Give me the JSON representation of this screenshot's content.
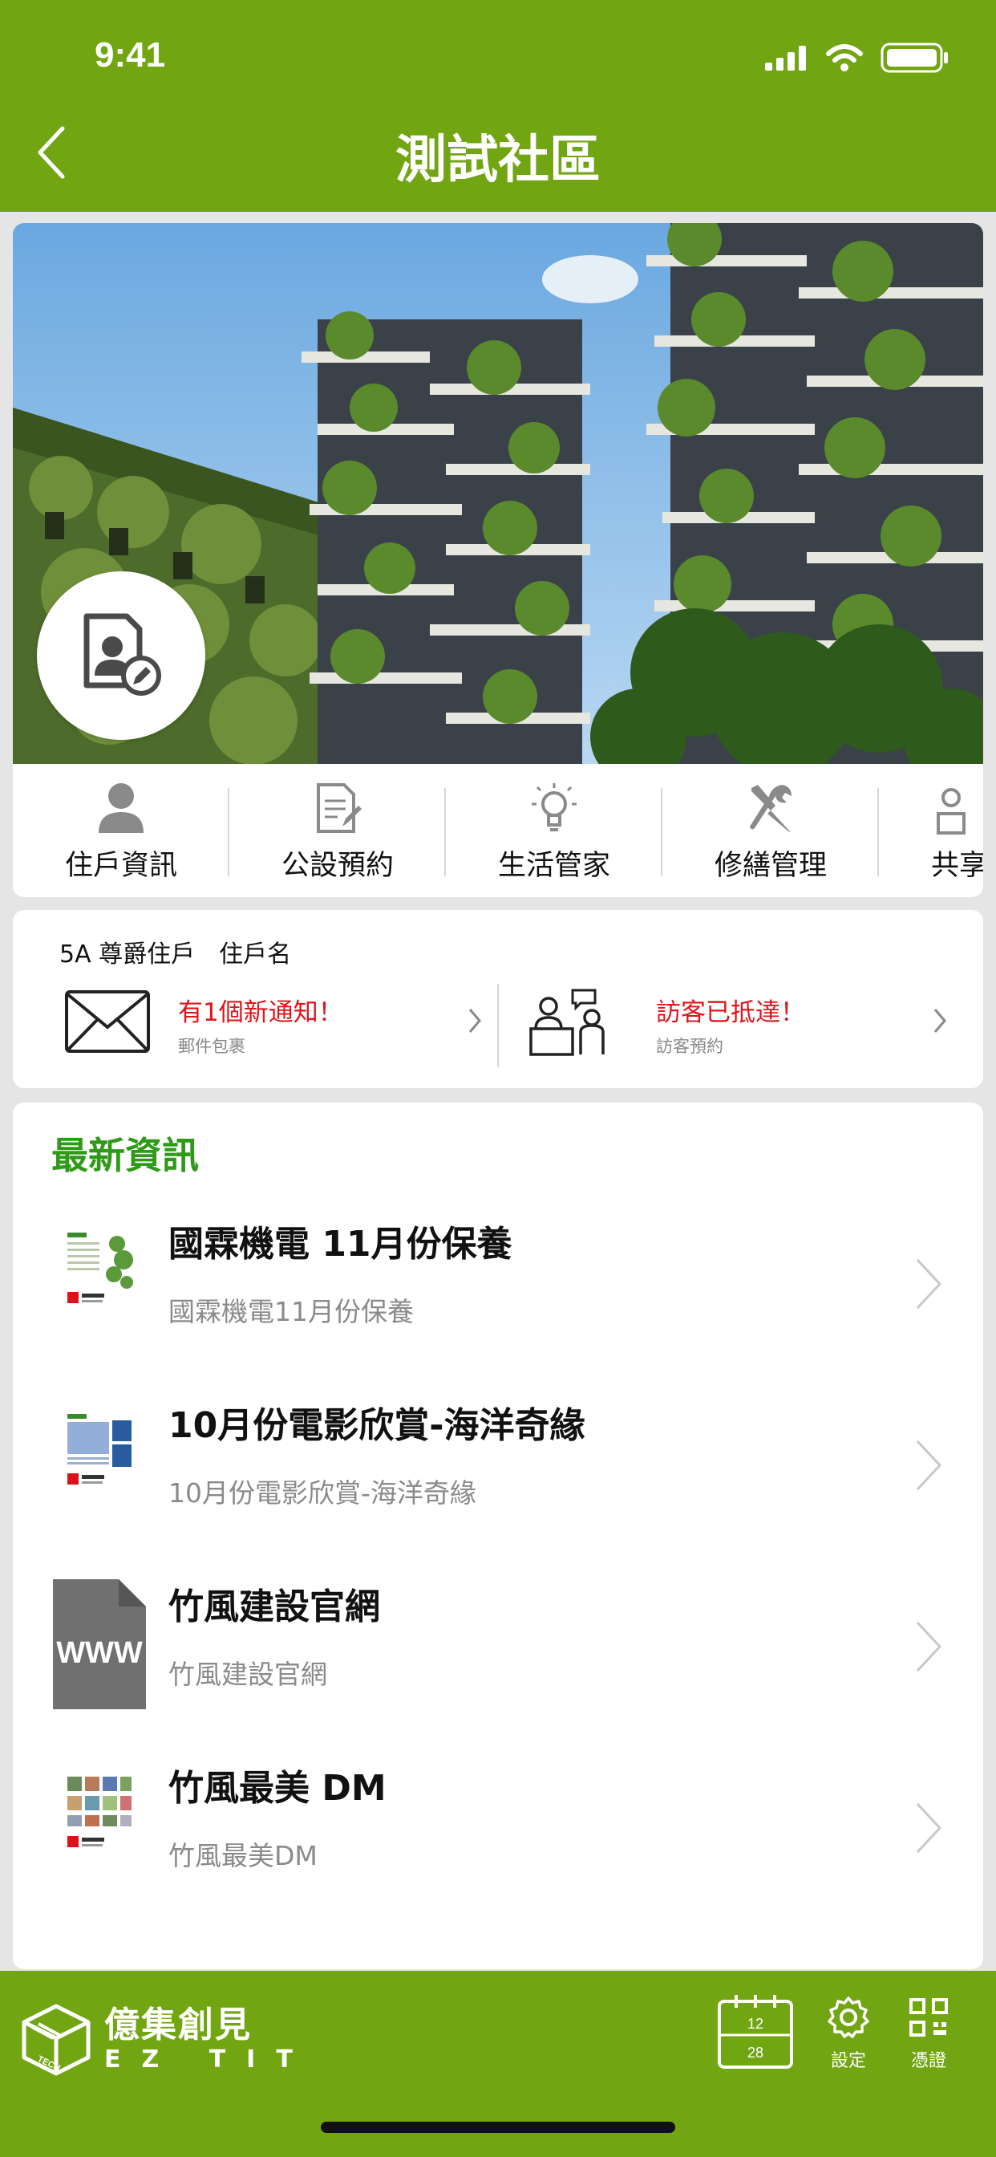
{
  "status": {
    "time": "9:41"
  },
  "header": {
    "title": "測試社區",
    "back_icon": "chevron-left-icon"
  },
  "menu": [
    {
      "label": "住戶資訊",
      "icon": "user-icon"
    },
    {
      "label": "公設預約",
      "icon": "document-edit-icon"
    },
    {
      "label": "生活管家",
      "icon": "lightbulb-icon"
    },
    {
      "label": "修繕管理",
      "icon": "tools-icon"
    },
    {
      "label": "共享",
      "icon": "share-icon"
    }
  ],
  "resident": {
    "unit": "5A 尊爵住戶",
    "name": "住戶名"
  },
  "notifications": {
    "mail": {
      "title": "有1個新通知！",
      "subtitle": "郵件包裹"
    },
    "visitor": {
      "title": "訪客已抵達！",
      "subtitle": "訪客預約"
    }
  },
  "news": {
    "title": "最新資訊",
    "items": [
      {
        "title": "國霖機電 11月份保養",
        "desc": "國霖機電11月份保養"
      },
      {
        "title": "10月份電影欣賞-海洋奇緣",
        "desc": "10月份電影欣賞-海洋奇緣"
      },
      {
        "title": "竹風建設官網",
        "desc": "竹風建設官網",
        "thumb_text": "WWW"
      },
      {
        "title": "竹風最美 DM",
        "desc": "竹風最美DM"
      }
    ]
  },
  "footer": {
    "brand_cn": "億集創見",
    "brand_en": "EZ TIT",
    "brand_badge": "TECH",
    "calendar": {
      "top": "12",
      "bottom": "28"
    },
    "settings_label": "設定",
    "credential_label": "憑證"
  },
  "colors": {
    "brand_green": "#71a512",
    "news_green": "#2f9a1a",
    "alert_red": "#e0141a"
  }
}
